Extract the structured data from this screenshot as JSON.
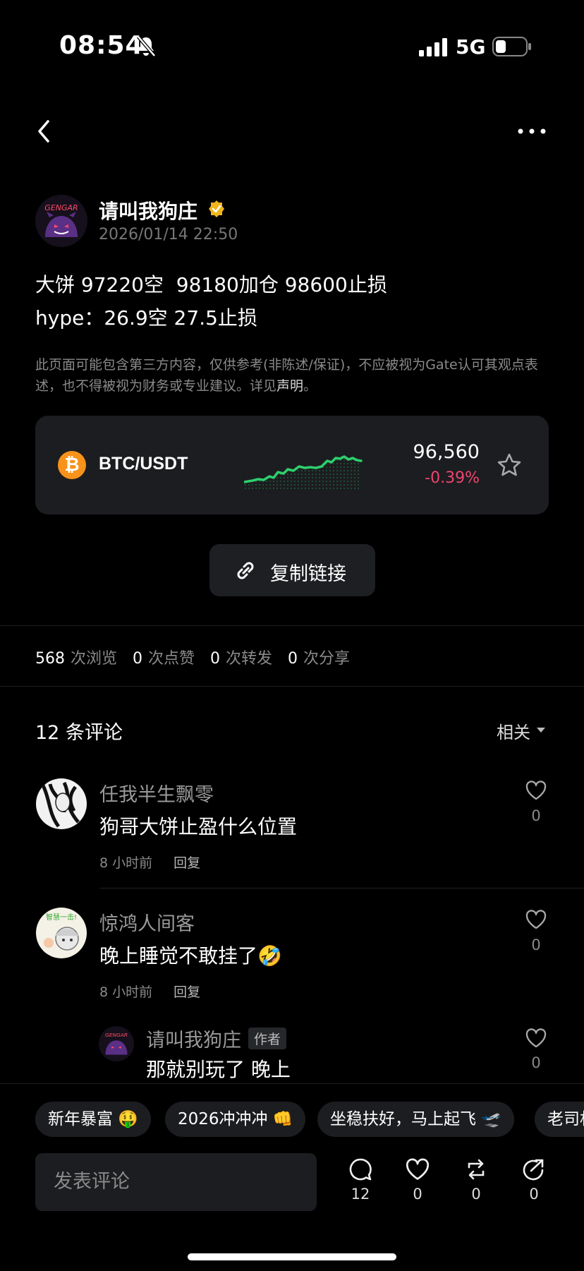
{
  "status_bar": {
    "time": "08:54",
    "network": "5G"
  },
  "post": {
    "author": "请叫我狗庄",
    "timestamp": "2026/01/14 22:50",
    "lines": [
      "大饼 97220空  98180加仓 98600止损",
      "hype：26.9空 27.5止损"
    ],
    "disclaimer_text": "此页面可能包含第三方内容，仅供参考(非陈述/保证)，不应被视为Gate认可其观点表述，也不得被视为财务或专业建议。详见",
    "disclaimer_link": "声明",
    "disclaimer_end": "。"
  },
  "ticker": {
    "pair": "BTC/USDT",
    "price": "96,560",
    "change": "-0.39%",
    "change_color": "#f0446f",
    "spark_color": "#2ecf6d",
    "coin_color": "#f7931a"
  },
  "copy_link_label": "复制链接",
  "stats": [
    {
      "n": "568",
      "t": "次浏览"
    },
    {
      "n": "0",
      "t": "次点赞"
    },
    {
      "n": "0",
      "t": "次转发"
    },
    {
      "n": "0",
      "t": "次分享"
    }
  ],
  "comments_header": {
    "title": "12 条评论",
    "sort": "相关"
  },
  "comments": [
    {
      "name": "任我半生飘零",
      "text": "狗哥大饼止盈什么位置",
      "time": "8 小时前",
      "reply": "回复",
      "likes": "0"
    },
    {
      "name": "惊鸿人间客",
      "text": "晚上睡觉不敢挂了🤣",
      "time": "8 小时前",
      "reply": "回复",
      "likes": "0"
    },
    {
      "name": "请叫我狗庄",
      "tag": "作者",
      "text": "那就别玩了 晚上",
      "likes": "0"
    }
  ],
  "chips": [
    "新年暴富 🤑",
    "2026冲冲冲 👊",
    "坐稳扶好，马上起飞 🛫",
    "老司机"
  ],
  "input_placeholder": "发表评论",
  "actions": {
    "comments": "12",
    "likes": "0",
    "reposts": "0",
    "shares": "0"
  }
}
